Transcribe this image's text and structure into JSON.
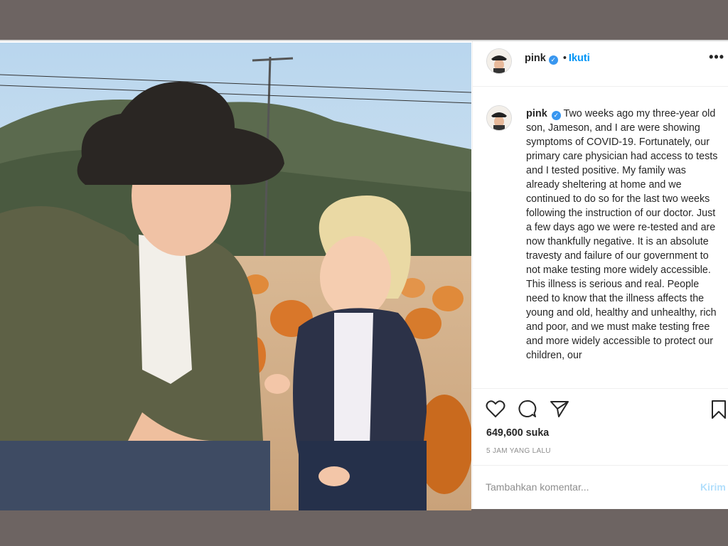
{
  "post": {
    "username": "pink",
    "verified_icon": "verified-badge-icon",
    "follow_separator": "•",
    "follow_label": "Ikuti",
    "more_icon": "more-options-icon",
    "more_label": "•••",
    "caption": "Two weeks ago my three-year old son, Jameson, and I are were showing symptoms of COVID-19. Fortunately, our primary care physician had access to tests and I tested positive. My family was already sheltering at home and we continued to do so for the last two weeks following the instruction of our doctor. Just a few days ago we were re-tested and are now thankfully negative. It is an absolute travesty and failure of our government to not make testing more widely accessible. This illness is serious and real. People need to know that the illness affects the young and old, healthy and unhealthy, rich and poor, and we must make testing free and more widely accessible to protect our children, our",
    "likes": "649,600 suka",
    "time_ago": "5 JAM YANG LALU",
    "comment_placeholder": "Tambahkan komentar...",
    "post_label": "Kirim",
    "accent_color": "#0095f6"
  }
}
